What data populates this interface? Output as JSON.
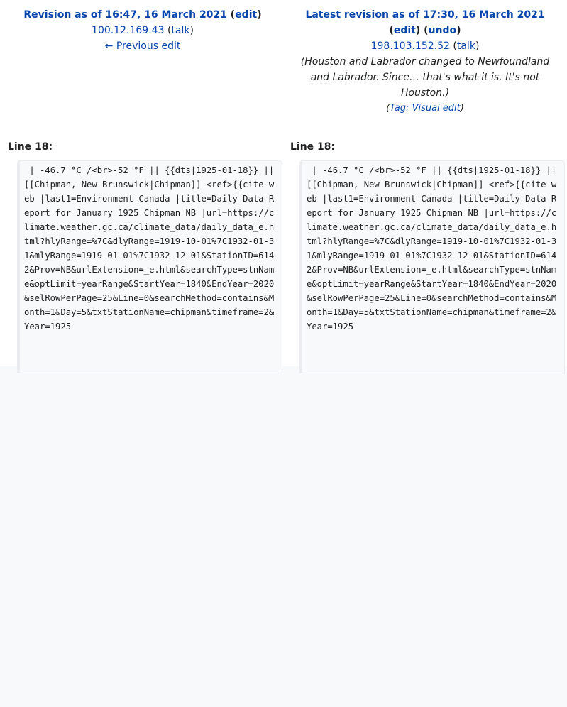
{
  "left": {
    "header_prefix": "Revision as of 16:47, 16 March 2021",
    "edit_label": "edit",
    "user_label": "100.12.169.43",
    "talk_label": "talk",
    "prev_label": "← Previous edit"
  },
  "right": {
    "header_prefix": "Latest revision as of 17:30, 16 March 2021",
    "edit_label": "edit",
    "undo_label": "undo",
    "user_label": "198.103.152.52",
    "talk_label": "talk",
    "summary": "(Houston and Labrador changed to Newfoundland and Labrador. Since… that's what it is. It's not Houston.)",
    "tag_prefix": "Tag:",
    "tag_label": "Visual edit"
  },
  "line_label": "Line 18:",
  "context_text": " | -46.7 °C /<br>-52 °F || {{dts|1925-01-18}} || [[Chipman, New Brunswick|Chipman]] <ref>{{cite web |last1=Environment Canada |title=Daily Data Report for January 1925 Chipman NB |url=https://climate.weather.gc.ca/climate_data/daily_data_e.html?hlyRange=%7C&dlyRange=1919-10-01%7C1932-01-31&mlyRange=1919-01-01%7C1932-12-01&StationID=6142&Prov=NB&urlExtension=_e.html&searchType=stnName&optLimit=yearRange&StartYear=1840&EndYear=2020&selRowPerPage=25&Line=0&searchMethod=contains&Month=1&Day=5&txtStationName=chipman&timeframe=2&Year=1925"
}
